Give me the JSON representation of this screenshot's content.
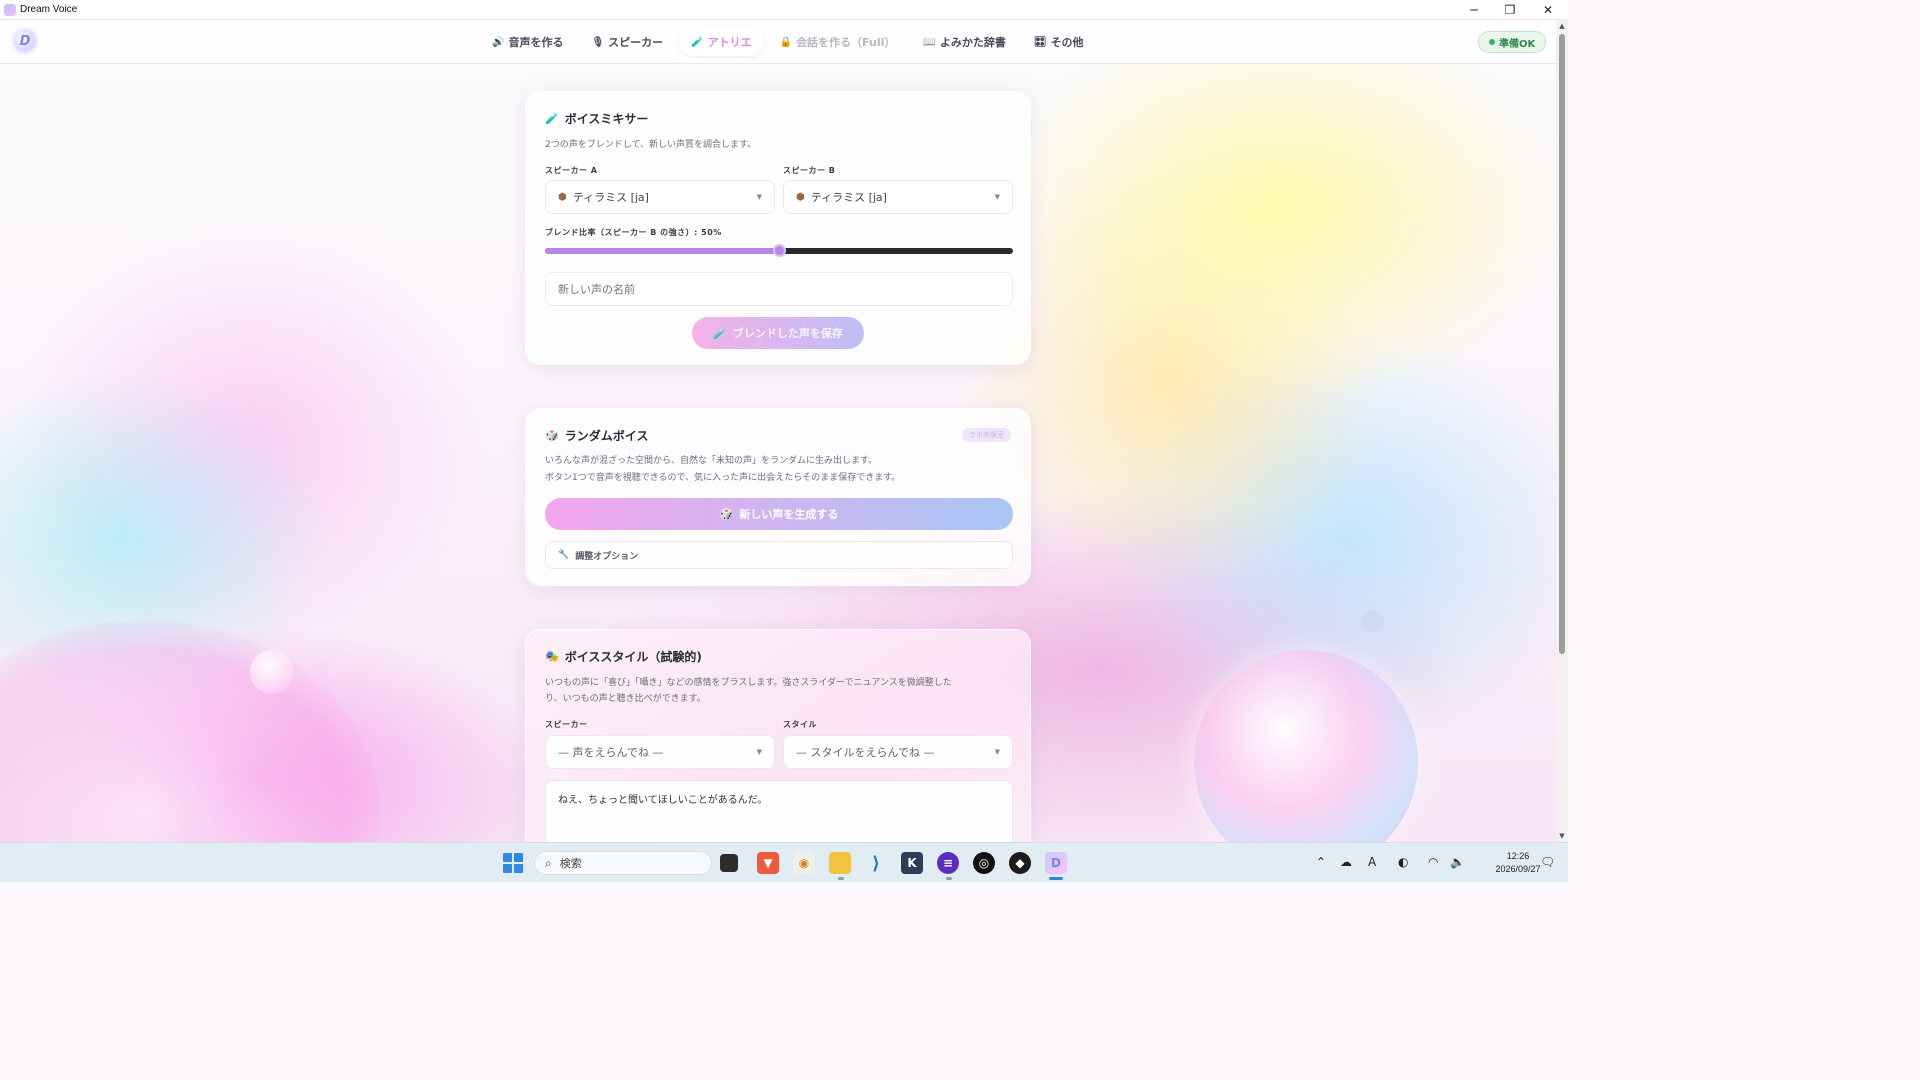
{
  "window": {
    "title": "Dream Voice"
  },
  "appbar": {
    "logo_glyph": "D",
    "nav": [
      {
        "icon": "🔊",
        "label": "音声を作る",
        "state": "normal"
      },
      {
        "icon": "🎙",
        "label": "スピーカー",
        "state": "normal"
      },
      {
        "icon": "🧪",
        "label": "アトリエ",
        "state": "active"
      },
      {
        "icon": "🔒",
        "label": "会話を作る（Full）",
        "state": "disabled"
      },
      {
        "icon": "📖",
        "label": "よみかた辞書",
        "state": "normal"
      },
      {
        "icon": "🎛",
        "label": "その他",
        "state": "normal"
      }
    ],
    "status": "準備OK"
  },
  "mixer": {
    "icon": "🧪",
    "title": "ボイスミキサー",
    "description": "2つの声をブレンドして、新しい声質を調合します。",
    "speaker_a_label": "スピーカー A",
    "speaker_a_value": "ティラミス [ja]",
    "speaker_b_label": "スピーカー B",
    "speaker_b_value": "ティラミス [ja]",
    "blend_label": "ブレンド比率（スピーカー B の強さ）: 50%",
    "blend_ratio": 0.5,
    "name_placeholder": "新しい声の名前",
    "save_button": "ブレンドした声を保存"
  },
  "random_voice": {
    "icon": "🎲",
    "title": "ランダムボイス",
    "badge": "ラボ実験室",
    "description_line1": "いろんな声が混ざった空間から、自然な「未知の声」をランダムに生み出します。",
    "description_line2": "ボタン1つで音声を視聴できるので、気に入った声に出会えたらそのまま保存できます。",
    "generate_button": "新しい声を生成する",
    "adjust_options": "調整オプション"
  },
  "voice_style": {
    "icon": "🎭",
    "title": "ボイススタイル（試験的)",
    "description_line1": "いつもの声に「喜び」「囁き」などの感情をプラスします。強さスライダーでニュアンスを微調整した",
    "description_line2": "り、いつもの声と聴き比べができます。",
    "speaker_label": "スピーカー",
    "speaker_placeholder": "— 声をえらんでね —",
    "style_label": "スタイル",
    "style_placeholder": "— スタイルをえらんでね —",
    "text_value": "ねえ、ちょっと聞いてほしいことがあるんだ。"
  },
  "taskbar": {
    "search_placeholder": "検索",
    "ime": "A",
    "time": "12:26",
    "date": "2026/09/27"
  },
  "colors": {
    "accent_pink": "#f5a9e6",
    "accent_blue": "#a9c6f5",
    "slider_fill": "#b786e8",
    "status_green": "#3bb25f"
  }
}
